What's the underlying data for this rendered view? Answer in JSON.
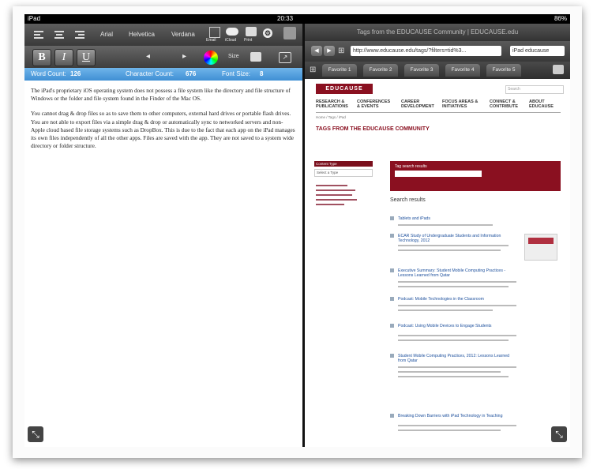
{
  "status_bar": {
    "carrier": "iPad",
    "time": "20:33",
    "battery": "86%"
  },
  "editor": {
    "toolbar_fonts": [
      "Arial",
      "Helvetica",
      "Verdana"
    ],
    "toolbar_actions": [
      "Email",
      "iCloud",
      "Print"
    ],
    "format_buttons": [
      "B",
      "I",
      "U"
    ],
    "size_label": "Size",
    "counters": {
      "words_label": "Word Count:",
      "words_value": "126",
      "chars_label": "Character Count:",
      "chars_value": "676",
      "font_label": "Font Size:",
      "font_value": "8"
    },
    "paragraphs": [
      "The iPad's proprietary iOS operating system does not possess a file system like the directory and file structure of Windows or the folder and file system found in the Finder of the Mac OS.",
      "You cannot drag & drop files so as to save them to other computers, external hard drives or portable flash drives. You are not able to export files via a simple drag & drop or automatically sync to networked servers and non-Apple cloud based file storage systems such as DropBox. This is due to the fact that each app on the iPad manages its own files independently of all the other apps. Files are saved with the app. They are not saved to a system wide directory or folder structure."
    ]
  },
  "browser": {
    "title": "Tags from the EDUCAUSE Community | EDUCAUSE.edu",
    "url": "http://www.educause.edu/tags/?filters=tid%3...",
    "search": "iPad educause",
    "favorites": [
      "Favorite 1",
      "Favorite 2",
      "Favorite 3",
      "Favorite 4",
      "Favorite 5"
    ],
    "site": {
      "logo": "EDUCAUSE",
      "search_placeholder": "Search",
      "nav": [
        "RESEARCH & PUBLICATIONS",
        "CONFERENCES & EVENTS",
        "CAREER DEVELOPMENT",
        "FOCUS AREAS & INITIATIVES",
        "CONNECT & CONTRIBUTE",
        "ABOUT EDUCAUSE"
      ],
      "breadcrumb": "Home / Tags / iPad",
      "page_title": "TAGS FROM THE EDUCAUSE COMMUNITY",
      "sidebar_head": "Content Type",
      "sidebar_input": "Select a Type",
      "search_box_label": "Tag search results",
      "results_label": "Search results",
      "results": [
        "Tablets and iPads",
        "ECAR Study of Undergraduate Students and Information Technology, 2012",
        "Executive Summary: Student Mobile Computing Practices - Lessons Learned from Qatar",
        "Podcast: Mobile Technologies in the Classroom",
        "Podcast: Using Mobile Devices to Engage Students",
        "Student Mobile Computing Practices, 2012: Lessons Learned from Qatar",
        "Breaking Down Barriers with iPad Technology in Teaching"
      ]
    }
  },
  "colors": {
    "accent_blue": "#4a9ae0",
    "brand_red": "#8a1020"
  }
}
